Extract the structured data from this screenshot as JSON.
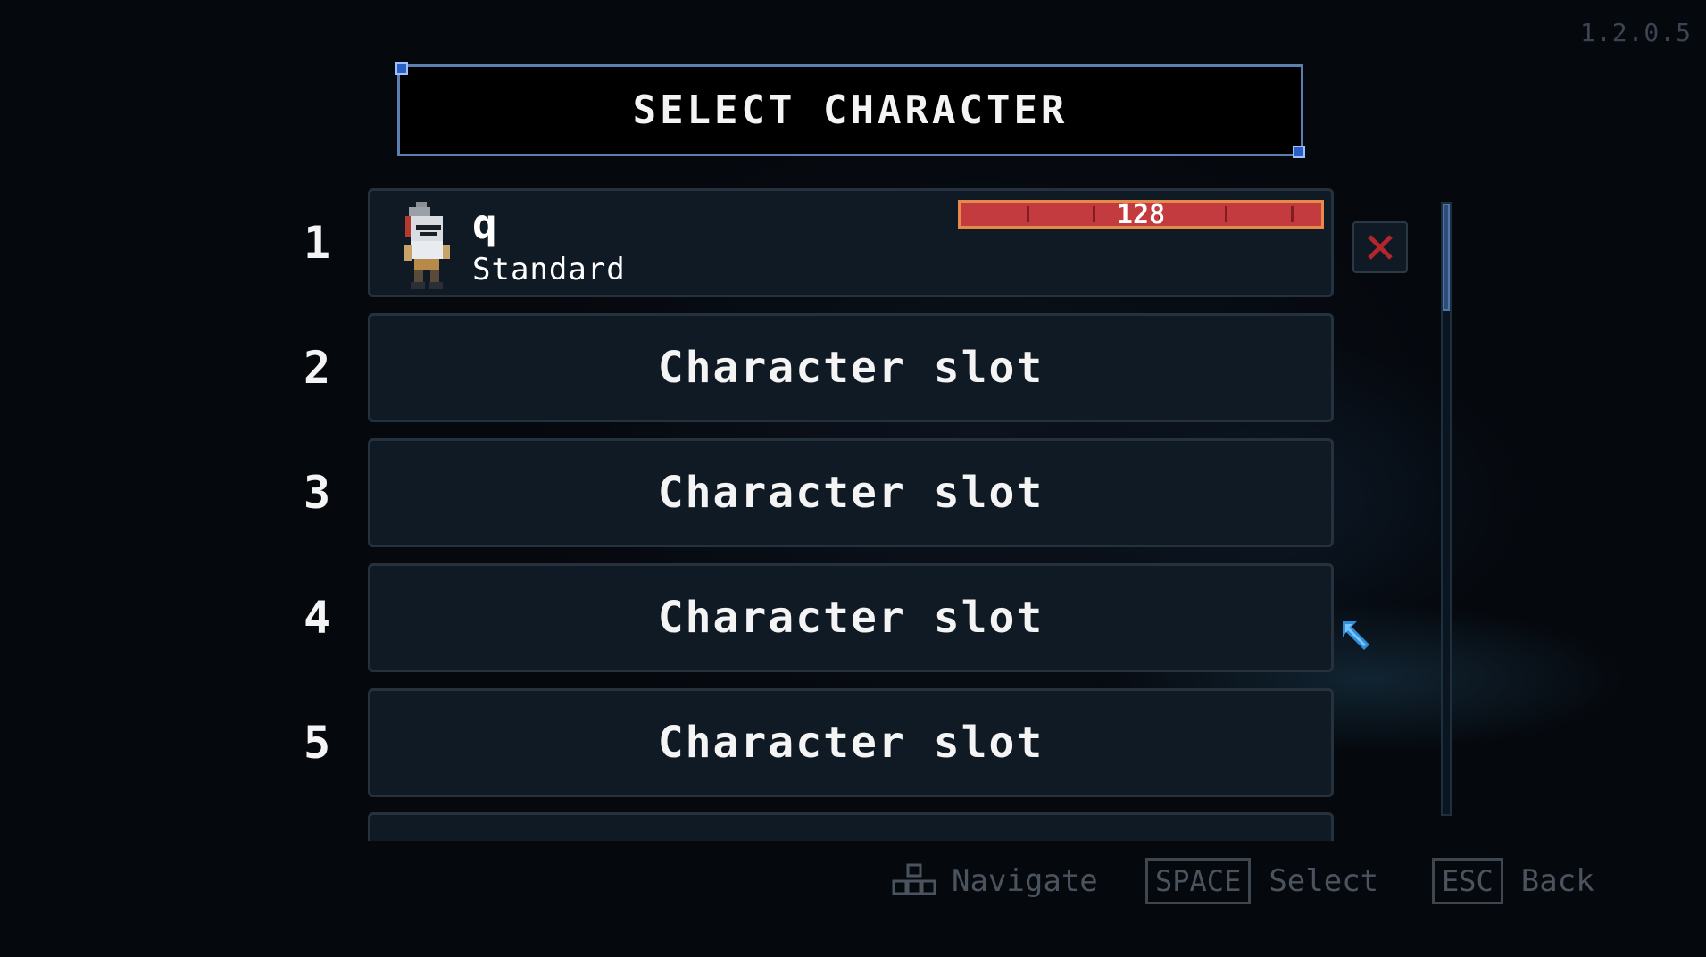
{
  "version": "1.2.0.5",
  "title": "SELECT CHARACTER",
  "slots": [
    {
      "number": "1",
      "name": "q",
      "class": "Standard",
      "hp": "128",
      "hp_fraction": 1.0
    },
    {
      "number": "2",
      "label": "Character slot"
    },
    {
      "number": "3",
      "label": "Character slot"
    },
    {
      "number": "4",
      "label": "Character slot"
    },
    {
      "number": "5",
      "label": "Character slot"
    }
  ],
  "hints": {
    "navigate": "Navigate",
    "space_key": "SPACE",
    "select": "Select",
    "esc_key": "ESC",
    "back": "Back"
  },
  "icons": {
    "delete": "close-icon",
    "navigate": "dpad-icon",
    "cursor": "cursor-arrow-icon",
    "avatar": "knight-avatar-icon"
  },
  "colors": {
    "hp_bar": "#c33b3f",
    "hp_border": "#e58a4a",
    "title_border": "#5d7fb0",
    "delete_x": "#b3262c",
    "cursor": "#2f8fd8"
  }
}
